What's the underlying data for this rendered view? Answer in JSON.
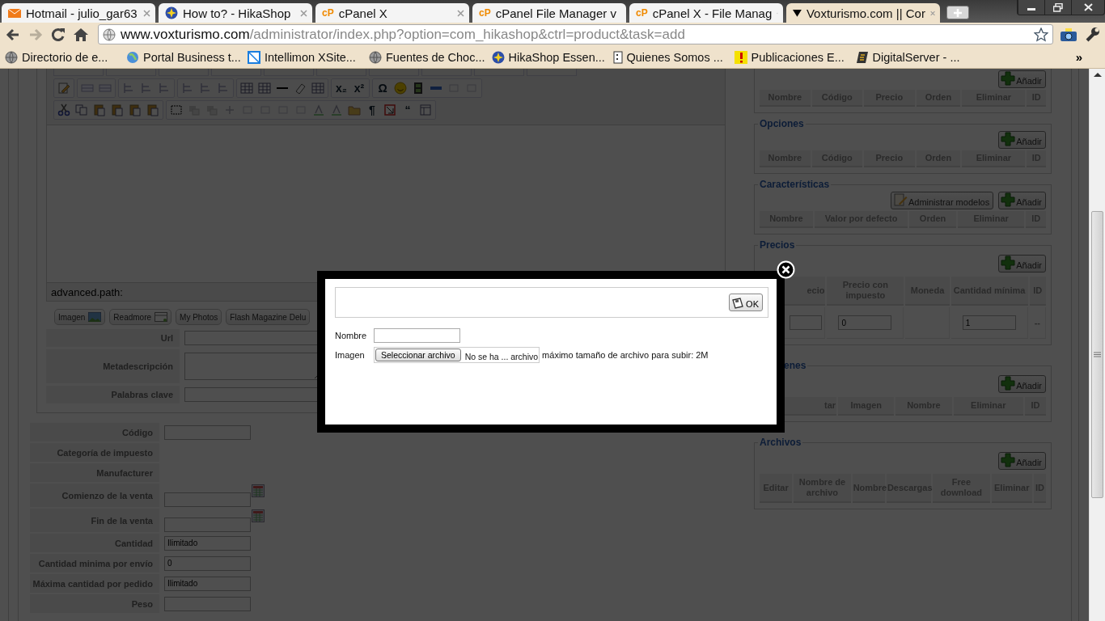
{
  "browser": {
    "tabs": [
      {
        "title": "Hotmail - julio_gar63",
        "selected": false
      },
      {
        "title": "How to? - HikaShop",
        "selected": false
      },
      {
        "title": "cPanel X",
        "logo_text": "cP",
        "selected": false
      },
      {
        "title": "cPanel File Manager v",
        "logo_text": "cP",
        "selected": false
      },
      {
        "title": "cPanel X - File Manag",
        "logo_text": "cP",
        "selected": false
      },
      {
        "title": "Voxturismo.com || Cor",
        "selected": true
      }
    ],
    "url_host": "www.voxturismo.com",
    "url_path": "/administrator/index.php?option=com_hikashop&ctrl=product&task=add",
    "bookmarks": [
      {
        "title": "Directorio de e..."
      },
      {
        "title": "Portal Business t..."
      },
      {
        "title": "Intellimon XSite..."
      },
      {
        "title": "Fuentes de Choc..."
      },
      {
        "title": "HikaShop Essen..."
      },
      {
        "title": "Quienes Somos ..."
      },
      {
        "title": "Publicaciones E..."
      },
      {
        "title": "DigitalServer - ..."
      }
    ],
    "more": "»"
  },
  "editor": {
    "toolbar_symbols": [
      "x₂",
      "x²",
      "Ω",
      "¶",
      "“"
    ],
    "status": "advanced.path:",
    "buttons": [
      {
        "label": "Imagen"
      },
      {
        "label": "Readmore"
      },
      {
        "label": "My Photos"
      },
      {
        "label": "Flash Magazine Delu"
      }
    ]
  },
  "meta_fields": [
    {
      "label": "Url",
      "kind": "input"
    },
    {
      "label": "Metadescripción",
      "kind": "textarea"
    },
    {
      "label": "Palabras clave",
      "kind": "input"
    }
  ],
  "product_fields": [
    {
      "label": "Código",
      "kind": "input"
    },
    {
      "label": "Categoría de impuesto",
      "kind": "none"
    },
    {
      "label": "Manufacturer",
      "kind": "none"
    },
    {
      "label": "Comienzo de la venta",
      "kind": "date"
    },
    {
      "label": "Fin de la venta",
      "kind": "date"
    },
    {
      "label": "Cantidad",
      "kind": "input",
      "value": "Ilimitado"
    },
    {
      "label": "Cantidad minima por envío",
      "kind": "input",
      "value": "0"
    },
    {
      "label": "Máxima cantidad por pedido",
      "kind": "input",
      "value": "Ilimitado"
    },
    {
      "label": "Peso",
      "kind": "input"
    }
  ],
  "sections": [
    {
      "buttons": [
        {
          "label": "Añadir",
          "kind": "add"
        }
      ],
      "columns": [
        "Nombre",
        "Código",
        "Precio",
        "Orden",
        "Eliminar",
        "ID"
      ]
    },
    {
      "legend": "Opciones",
      "buttons": [
        {
          "label": "Añadir",
          "kind": "add"
        }
      ],
      "columns": [
        "Nombre",
        "Código",
        "Precio",
        "Orden",
        "Eliminar",
        "ID"
      ]
    },
    {
      "legend": "Características",
      "buttons": [
        {
          "label": "Administrar modelos",
          "kind": "manage"
        },
        {
          "label": "Añadir",
          "kind": "add"
        }
      ],
      "columns": [
        "Nombre",
        "Valor por defecto",
        "Orden",
        "Eliminar",
        "ID"
      ]
    },
    {
      "legend": "Precios",
      "first_column_covered": true,
      "buttons": [
        {
          "label": "Añadir",
          "kind": "add"
        }
      ],
      "columns": [
        "ecio",
        "Precio con impuesto",
        "Moneda",
        "Cantidad mínima",
        "ID"
      ],
      "rows": [
        [
          {
            "kind": "input"
          },
          {
            "kind": "input",
            "value": "0"
          },
          {
            "kind": "empty"
          },
          {
            "kind": "input",
            "value": "1"
          },
          {
            "kind": "text",
            "value": "--"
          }
        ]
      ]
    },
    {
      "legend": "enes",
      "legend_covered": true,
      "first_column_covered": true,
      "buttons": [
        {
          "label": "Añadir",
          "kind": "add"
        }
      ],
      "columns": [
        "tar",
        "Imagen",
        "Nombre",
        "Eliminar",
        "ID"
      ]
    },
    {
      "legend": "Archivos",
      "buttons": [
        {
          "label": "Añadir",
          "kind": "add"
        }
      ],
      "columns": [
        "Editar",
        "Nombre de archivo",
        "Nombre",
        "Descargas",
        "Free download",
        "Eliminar",
        "ID"
      ]
    }
  ],
  "dialog": {
    "ok": "OK",
    "fields": [
      {
        "label": "Nombre",
        "kind": "input"
      },
      {
        "label": "Imagen",
        "kind": "file",
        "button": "Seleccionar archivo",
        "status": "No se ha ... archivo",
        "note": "máximo tamaño de archivo para subir: 2M"
      }
    ]
  }
}
